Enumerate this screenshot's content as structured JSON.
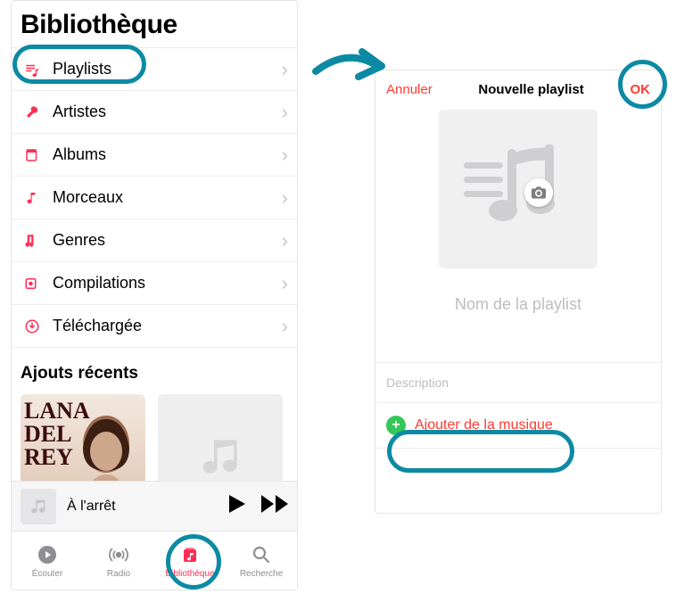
{
  "left": {
    "title": "Bibliothèque",
    "items": [
      {
        "label": "Playlists"
      },
      {
        "label": "Artistes"
      },
      {
        "label": "Albums"
      },
      {
        "label": "Morceaux"
      },
      {
        "label": "Genres"
      },
      {
        "label": "Compilations"
      },
      {
        "label": "Téléchargée"
      }
    ],
    "recents_title": "Ajouts récents",
    "album1": {
      "line1": "LANA",
      "line2": "DEL",
      "line3": "REY"
    },
    "now_playing": "À l'arrêt",
    "tabs": [
      {
        "label": "Écouter"
      },
      {
        "label": "Radio"
      },
      {
        "label": "Bibliothèque"
      },
      {
        "label": "Recherche"
      }
    ]
  },
  "right": {
    "cancel": "Annuler",
    "title": "Nouvelle playlist",
    "ok": "OK",
    "name_placeholder": "Nom de la playlist",
    "description_placeholder": "Description",
    "add_music": "Ajouter de la musique"
  },
  "colors": {
    "accent_pink": "#ff2d55",
    "red": "#ff3b30",
    "green": "#34c759",
    "highlight": "#0c8aa3"
  }
}
